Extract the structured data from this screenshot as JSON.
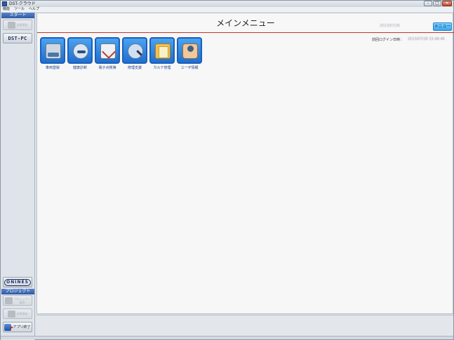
{
  "window": {
    "title": "DST-クラウド"
  },
  "menubar": {
    "items": [
      "機能",
      "ツール",
      "ヘルプ"
    ]
  },
  "window_controls": {
    "minimize": "–",
    "maximize": "□",
    "close": "✕"
  },
  "sidebar": {
    "start_header": "スタート",
    "disabled_btn_1": "診断開始",
    "dst_pc_label": "DST-PC",
    "onines_label": "ONINES",
    "project_header": "プロジェクト",
    "project_btn_label": "プロジェクト 選択",
    "disabled_btn_2": "診断開始",
    "exit_label": "アプリ終了"
  },
  "main": {
    "title": "メインメニュー",
    "date": "2013/07/26",
    "menu_button": "メニュー",
    "last_login_label": "前回ログイン日時：",
    "last_login_value": "2013/07/26 15:48:46",
    "tiles": [
      {
        "label": "車両登録",
        "icon": "vehicle-registration-icon"
      },
      {
        "label": "健康診断",
        "icon": "health-check-icon"
      },
      {
        "label": "電子点検簿",
        "icon": "electronic-inspection-icon"
      },
      {
        "label": "修理支援",
        "icon": "repair-support-icon"
      },
      {
        "label": "カルテ管理",
        "icon": "chart-management-icon"
      },
      {
        "label": "ユーザ情報",
        "icon": "user-info-icon"
      }
    ]
  },
  "colors": {
    "accent_blue": "#1f6fd0",
    "header_rule_red": "#c0392b",
    "menu_button_cyan": "#3ba6ea"
  }
}
